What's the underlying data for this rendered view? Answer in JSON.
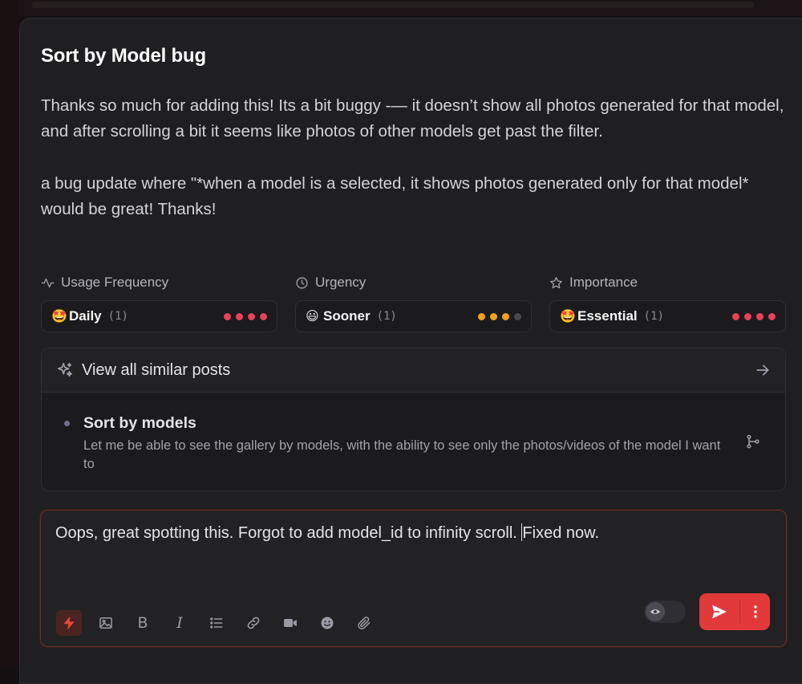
{
  "post": {
    "title": "Sort by Model bug",
    "paragraph1": "Thanks so much for adding this! Its a bit buggy -— it doesn’t show all photos generated for that model, and after scrolling a bit it seems like photos of other models get past the filter.",
    "paragraph2": " a bug update where \"*when a model is a selected, it shows photos generated only for that model* would be great! Thanks!"
  },
  "metrics": [
    {
      "label": "Usage Frequency",
      "icon": "activity-icon",
      "emoji": "🤩",
      "value": "Daily",
      "count": "(1)",
      "level": 4,
      "max": 4,
      "color": "#e8415a"
    },
    {
      "label": "Urgency",
      "icon": "clock-icon",
      "emoji": "😃",
      "value": "Sooner",
      "count": "(1)",
      "level": 3,
      "max": 4,
      "color": "#f2a01e"
    },
    {
      "label": "Importance",
      "icon": "star-icon",
      "emoji": "🤩",
      "value": "Essential",
      "count": "(1)",
      "level": 4,
      "max": 4,
      "color": "#e8415a"
    }
  ],
  "similar": {
    "header": "View all similar posts",
    "items": [
      {
        "title": "Sort by models",
        "body": "Let me be able to see the gallery by models, with the ability to see only the photos/videos of the model I want to"
      }
    ]
  },
  "composer": {
    "text_before_caret": "Oops, great spotting this. Forgot to add model_id to infinity scroll. ",
    "text_after_caret": "Fixed now.",
    "tools": [
      "bolt-icon",
      "image-icon",
      "bold-icon",
      "italic-icon",
      "list-icon",
      "link-icon",
      "video-icon",
      "emoji-icon",
      "attachment-icon"
    ]
  },
  "colors": {
    "accent": "#e23a3a",
    "border_focus": "#6b2e2a",
    "dot_off": "#4a4a4e"
  }
}
